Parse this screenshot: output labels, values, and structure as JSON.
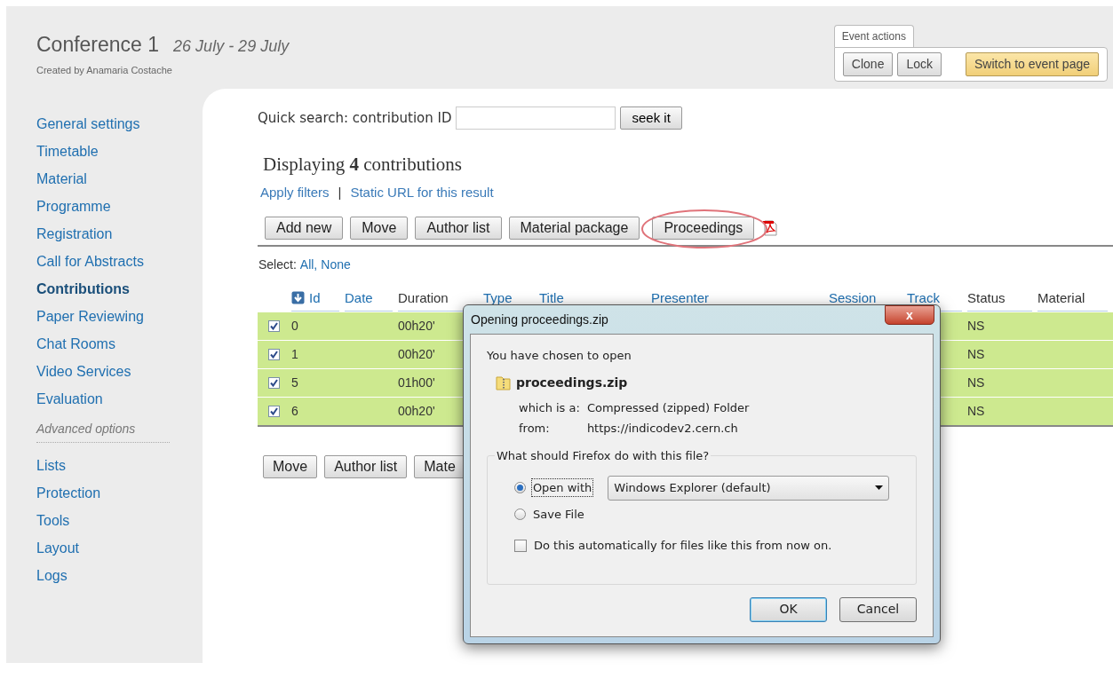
{
  "header": {
    "title": "Conference 1",
    "dates": "26 July - 29 July",
    "created_by": "Created by Anamaria Costache"
  },
  "event_actions": {
    "label": "Event actions",
    "buttons": [
      {
        "label": "Clone",
        "kind": "plain"
      },
      {
        "label": "Lock",
        "kind": "plain"
      },
      {
        "label": "Switch to event page",
        "kind": "primary"
      }
    ]
  },
  "sidebar": {
    "items": [
      {
        "label": "General settings",
        "selected": false
      },
      {
        "label": "Timetable",
        "selected": false
      },
      {
        "label": "Material",
        "selected": false
      },
      {
        "label": "Programme",
        "selected": false
      },
      {
        "label": "Registration",
        "selected": false
      },
      {
        "label": "Call for Abstracts",
        "selected": false
      },
      {
        "label": "Contributions",
        "selected": true
      },
      {
        "label": "Paper Reviewing",
        "selected": false
      },
      {
        "label": "Chat Rooms",
        "selected": false
      },
      {
        "label": "Video Services",
        "selected": false
      },
      {
        "label": "Evaluation",
        "selected": false
      }
    ],
    "section": "Advanced options",
    "advanced_items": [
      {
        "label": "Lists",
        "selected": false
      },
      {
        "label": "Protection",
        "selected": false
      },
      {
        "label": "Tools",
        "selected": false
      },
      {
        "label": "Layout",
        "selected": false
      },
      {
        "label": "Logs",
        "selected": false
      }
    ]
  },
  "quick_search": {
    "label": "Quick search: contribution ID",
    "button": "seek it"
  },
  "heading": "Displaying **4** contributions",
  "links": [
    "Apply filters",
    "Static URL for this result"
  ],
  "links_separator": "|",
  "toolbar": [
    {
      "label": "Add new",
      "highlighted": false
    },
    {
      "label": "Move",
      "highlighted": false
    },
    {
      "label": "Author list",
      "highlighted": false
    },
    {
      "label": "Material package",
      "highlighted": false
    },
    {
      "label": "Proceedings",
      "highlighted": true
    }
  ],
  "select": {
    "label": "Select:",
    "options": [
      "All,",
      "None"
    ]
  },
  "table": {
    "columns": [
      {
        "label": "Id",
        "link": true
      },
      {
        "label": "Date",
        "link": true
      },
      {
        "label": "Duration",
        "link": false
      },
      {
        "label": "Type",
        "link": true
      },
      {
        "label": "Title",
        "link": true
      },
      {
        "label": "Presenter",
        "link": true
      },
      {
        "label": "Session",
        "link": true
      },
      {
        "label": "Track",
        "link": true
      },
      {
        "label": "Status",
        "link": false
      },
      {
        "label": "Material",
        "link": false
      }
    ],
    "rows": [
      {
        "checked": true,
        "id": "0",
        "duration": "00h20'",
        "status": "NS"
      },
      {
        "checked": true,
        "id": "1",
        "duration": "00h20'",
        "status": "NS"
      },
      {
        "checked": true,
        "id": "5",
        "duration": "01h00'",
        "status": "NS"
      },
      {
        "checked": true,
        "id": "6",
        "duration": "00h20'",
        "status": "NS"
      }
    ]
  },
  "bottom_toolbar": [
    "Move",
    "Author list",
    "Mate"
  ],
  "dialog": {
    "title": "Opening proceedings.zip",
    "close": "x",
    "intro": "You have chosen to open",
    "file_name": "proceedings.zip",
    "type_label": "which is a:",
    "type_value": "Compressed (zipped) Folder",
    "from_label": "from:",
    "from_value": "https://indicodev2.cern.ch",
    "question": "What should Firefox do with this file?",
    "options": [
      {
        "label": "Open with",
        "selected": true
      },
      {
        "label": "Save File",
        "selected": false
      }
    ],
    "app": "Windows Explorer (default)",
    "auto": {
      "label": "Do this automatically for files like this from now on.",
      "checked": false
    },
    "buttons": [
      {
        "label": "OK",
        "kind": "default"
      },
      {
        "label": "Cancel",
        "kind": "plain"
      }
    ]
  }
}
